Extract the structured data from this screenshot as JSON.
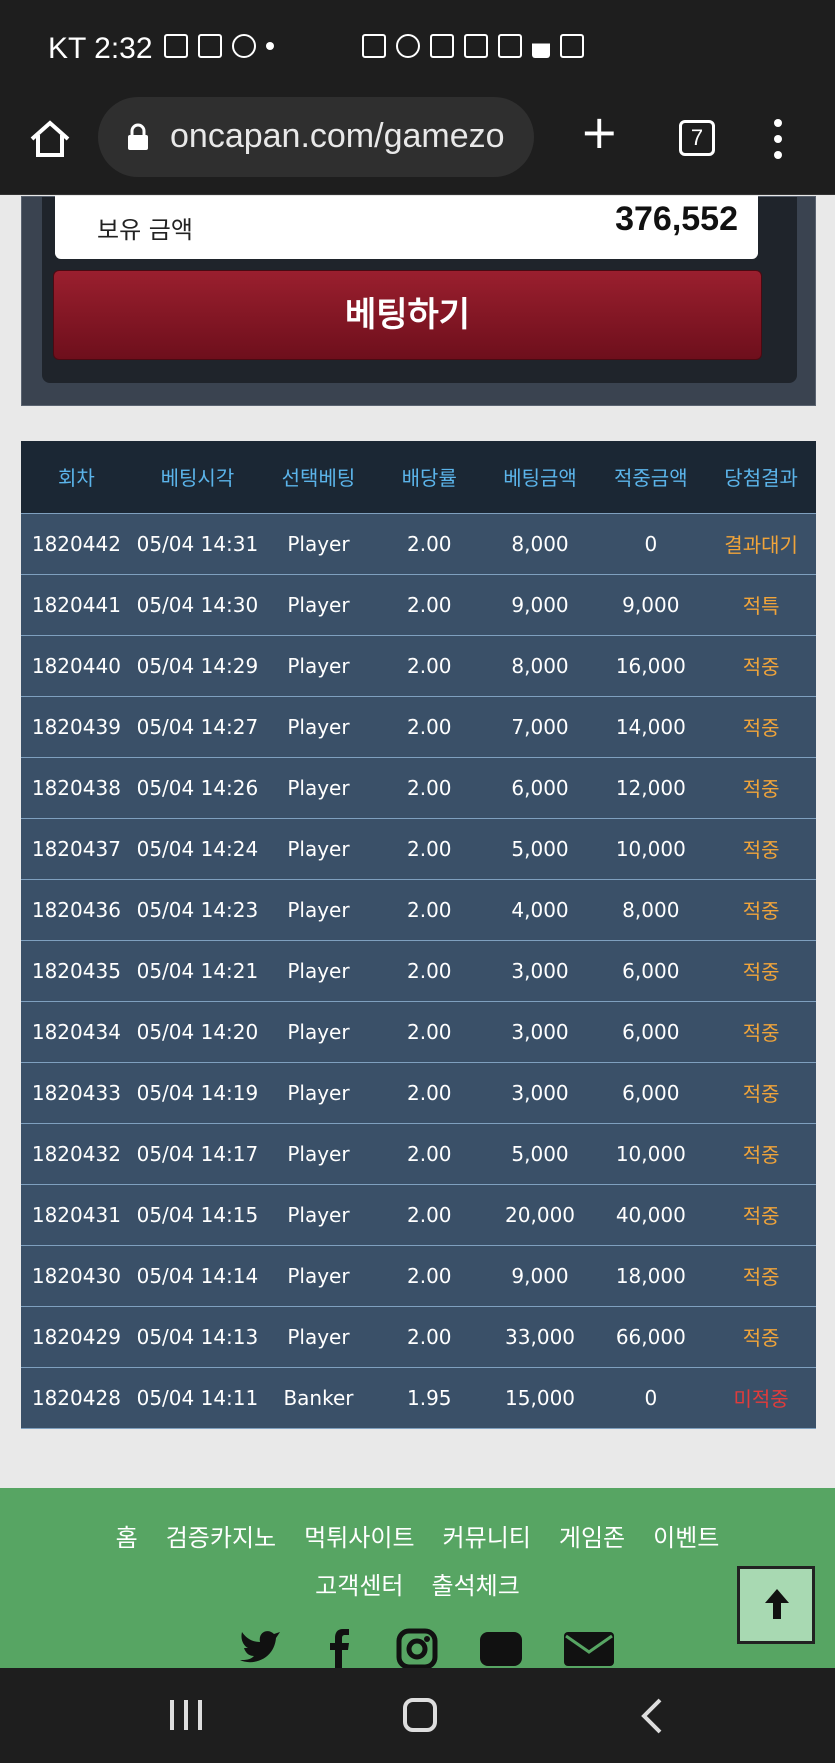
{
  "status": {
    "carrier_time": "KT 2:32"
  },
  "browser": {
    "url": "oncapan.com/gamezo",
    "tab_count": "7"
  },
  "bet": {
    "balance_label": "보유 금액",
    "balance_value": "376,552",
    "bet_button": "베팅하기"
  },
  "table": {
    "headers": [
      "회차",
      "베팅시각",
      "선택베팅",
      "배당률",
      "베팅금액",
      "적중금액",
      "당첨결과"
    ],
    "rows": [
      [
        "1820442",
        "05/04 14:31",
        "Player",
        "2.00",
        "8,000",
        "0",
        "결과대기"
      ],
      [
        "1820441",
        "05/04 14:30",
        "Player",
        "2.00",
        "9,000",
        "9,000",
        "적특"
      ],
      [
        "1820440",
        "05/04 14:29",
        "Player",
        "2.00",
        "8,000",
        "16,000",
        "적중"
      ],
      [
        "1820439",
        "05/04 14:27",
        "Player",
        "2.00",
        "7,000",
        "14,000",
        "적중"
      ],
      [
        "1820438",
        "05/04 14:26",
        "Player",
        "2.00",
        "6,000",
        "12,000",
        "적중"
      ],
      [
        "1820437",
        "05/04 14:24",
        "Player",
        "2.00",
        "5,000",
        "10,000",
        "적중"
      ],
      [
        "1820436",
        "05/04 14:23",
        "Player",
        "2.00",
        "4,000",
        "8,000",
        "적중"
      ],
      [
        "1820435",
        "05/04 14:21",
        "Player",
        "2.00",
        "3,000",
        "6,000",
        "적중"
      ],
      [
        "1820434",
        "05/04 14:20",
        "Player",
        "2.00",
        "3,000",
        "6,000",
        "적중"
      ],
      [
        "1820433",
        "05/04 14:19",
        "Player",
        "2.00",
        "3,000",
        "6,000",
        "적중"
      ],
      [
        "1820432",
        "05/04 14:17",
        "Player",
        "2.00",
        "5,000",
        "10,000",
        "적중"
      ],
      [
        "1820431",
        "05/04 14:15",
        "Player",
        "2.00",
        "20,000",
        "40,000",
        "적중"
      ],
      [
        "1820430",
        "05/04 14:14",
        "Player",
        "2.00",
        "9,000",
        "18,000",
        "적중"
      ],
      [
        "1820429",
        "05/04 14:13",
        "Player",
        "2.00",
        "33,000",
        "66,000",
        "적중"
      ],
      [
        "1820428",
        "05/04 14:11",
        "Banker",
        "1.95",
        "15,000",
        "0",
        "미적중"
      ]
    ]
  },
  "footer": {
    "nav1": [
      "홈",
      "검증카지노",
      "먹튀사이트",
      "커뮤니티",
      "게임존",
      "이벤트"
    ],
    "nav2": [
      "고객센터",
      "출석체크"
    ],
    "social_icons": [
      "twitter-icon",
      "facebook-icon",
      "instagram-icon",
      "youtube-icon",
      "mail-icon"
    ]
  },
  "colors": {
    "header_text": "#5bb4ea",
    "result_win": "#f0a43a",
    "result_lose": "#e23b3b",
    "footer_bg": "#57a563"
  }
}
